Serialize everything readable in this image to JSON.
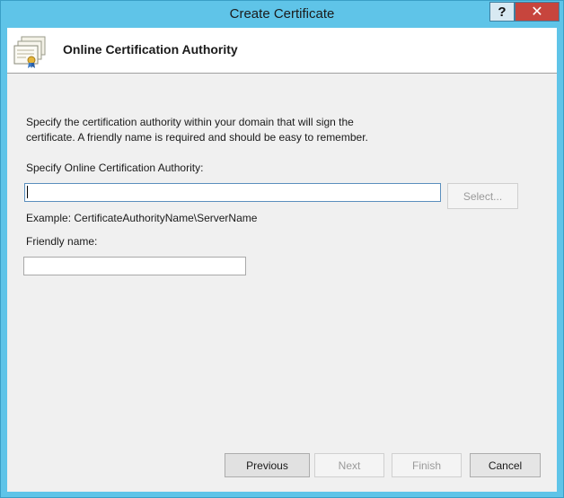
{
  "window": {
    "title": "Create Certificate",
    "help_label": "?",
    "close_label": "✕"
  },
  "header": {
    "title": "Online Certification Authority",
    "icon": "certificate-icon"
  },
  "body": {
    "description": "Specify the certification authority within your domain that will sign the certificate. A friendly name is required and should be easy to remember.",
    "ca_label": "Specify Online Certification Authority:",
    "ca_value": "",
    "select_label": "Select...",
    "example": "Example: CertificateAuthorityName\\ServerName",
    "friendly_label": "Friendly name:",
    "friendly_value": ""
  },
  "footer": {
    "previous": "Previous",
    "next": "Next",
    "finish": "Finish",
    "cancel": "Cancel"
  },
  "colors": {
    "titlebar": "#5fc4e8",
    "close_button": "#c7453d",
    "dialog_background": "#f0f0f0"
  }
}
